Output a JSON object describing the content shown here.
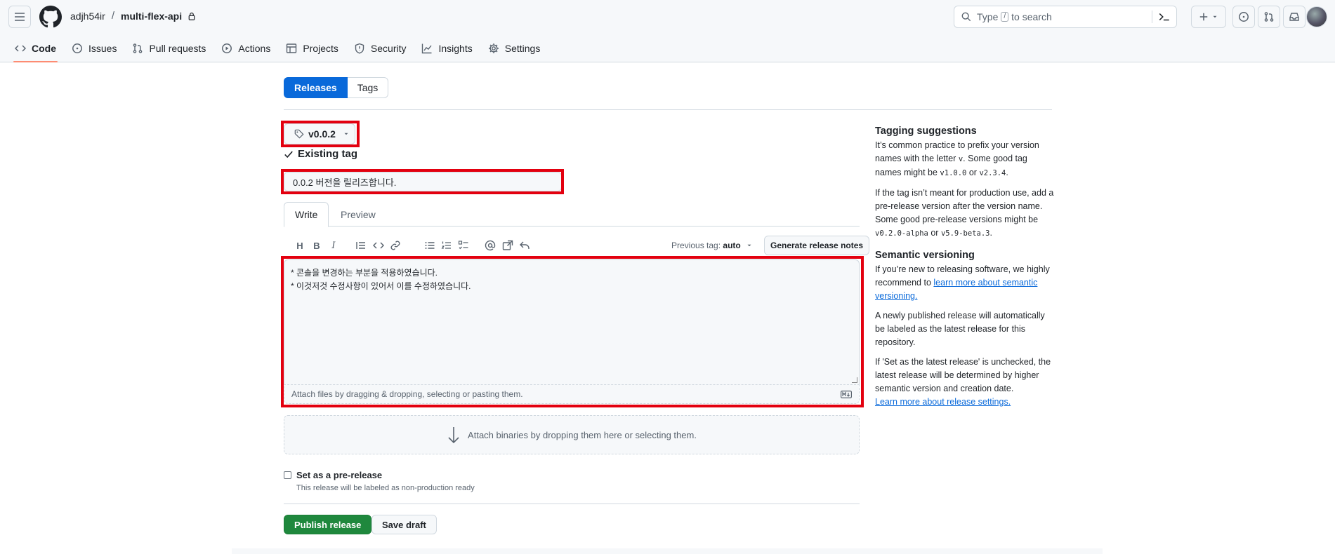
{
  "header": {
    "owner": "adjh54ir",
    "separator": "/",
    "repo": "multi-flex-api",
    "search_before": "Type",
    "search_key": "/",
    "search_after": "to search"
  },
  "nav_tabs": [
    {
      "label": "Code",
      "icon": "code-icon"
    },
    {
      "label": "Issues",
      "icon": "issue-opened-icon"
    },
    {
      "label": "Pull requests",
      "icon": "git-pull-request-icon"
    },
    {
      "label": "Actions",
      "icon": "play-icon"
    },
    {
      "label": "Projects",
      "icon": "table-icon"
    },
    {
      "label": "Security",
      "icon": "shield-icon"
    },
    {
      "label": "Insights",
      "icon": "graph-icon"
    },
    {
      "label": "Settings",
      "icon": "gear-icon"
    }
  ],
  "segment": {
    "releases": "Releases",
    "tags": "Tags"
  },
  "release_form": {
    "tag": "v0.0.2",
    "tag_status": "Existing tag",
    "title_value": "0.0.2 버전을 릴리즈합니다.",
    "write_tab": "Write",
    "preview_tab": "Preview",
    "previous_tag_label": "Previous tag:",
    "previous_tag_value": "auto",
    "generate_notes": "Generate release notes",
    "body_lines": [
      "* 콘솔을 변경하는 부분을 적용하였습니다.",
      "* 이것저것 수정사항이 있어서 이를 수정하였습니다."
    ],
    "attach_files": "Attach files by dragging & dropping, selecting or pasting them.",
    "attach_binaries": "Attach binaries by dropping them here or selecting them.",
    "prerelease_label": "Set as a pre-release",
    "prerelease_note": "This release will be labeled as non-production ready",
    "prerelease_checked": false,
    "publish": "Publish release",
    "save_draft": "Save draft"
  },
  "sidebar": {
    "tagging_title": "Tagging suggestions",
    "tagging_p1_a": "It’s common practice to prefix your version names with the letter",
    "tagging_p1_code1": "v",
    "tagging_p1_b": ". Some good tag names might be",
    "tagging_p1_code2": "v1.0.0",
    "tagging_p1_c": "or",
    "tagging_p1_code3": "v2.3.4",
    "tagging_p1_d": ".",
    "tagging_p2_a": "If the tag isn’t meant for production use, add a pre-release version after the version name. Some good pre-release versions might be",
    "tagging_p2_code1": "v0.2.0-alpha",
    "tagging_p2_b": "or",
    "tagging_p2_code2": "v5.9-beta.3",
    "tagging_p2_c": ".",
    "semver_title": "Semantic versioning",
    "semver_p1": "If you’re new to releasing software, we highly recommend to",
    "semver_link": "learn more about semantic versioning.",
    "semver_p2": "A newly published release will automatically be labeled as the latest release for this repository.",
    "semver_p3": "If 'Set as the latest release' is unchecked, the latest release will be determined by higher semantic version and creation date.",
    "settings_link": "Learn more about release settings."
  },
  "colors": {
    "accent": "#0969da",
    "publish_green": "#1f883d",
    "highlight_red": "#e3000f",
    "active_tab_underline": "#fd8c73"
  }
}
